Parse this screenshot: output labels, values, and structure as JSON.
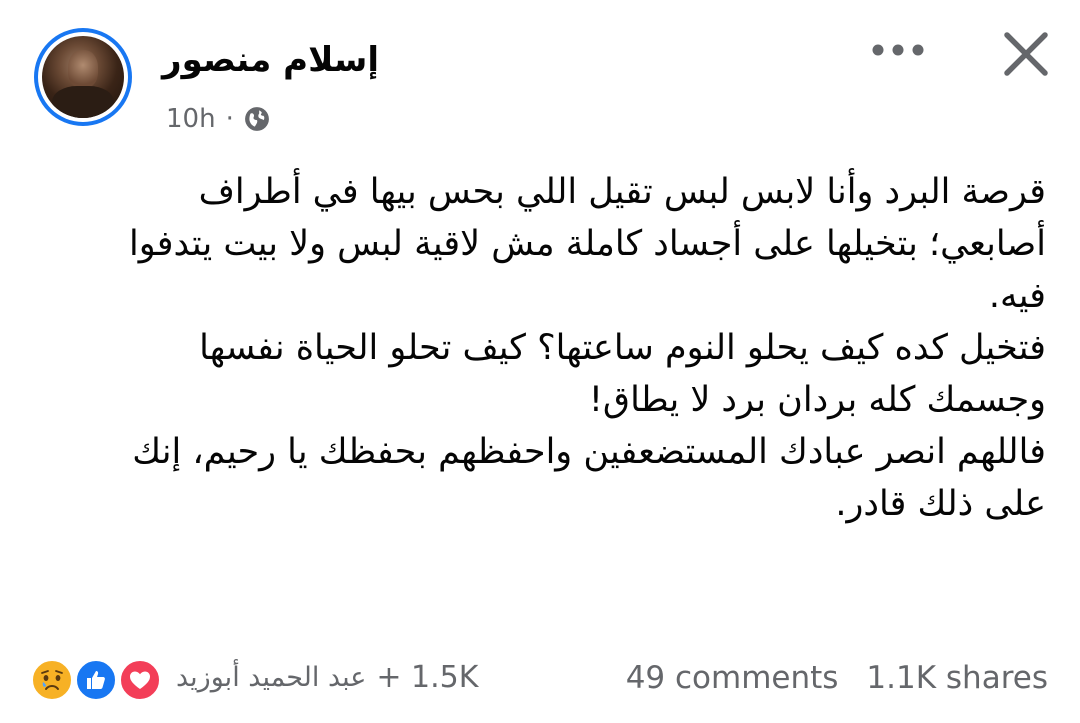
{
  "post": {
    "author": "إسلام منصور",
    "time": "10h",
    "separator": "·",
    "audience_icon": "globe-icon",
    "lines": [
      "قرصة البرد وأنا لابس لبس تقيل اللي بحس بيها في أطراف",
      "أصابعي؛ بتخيلها على أجساد كاملة مش لاقية لبس ولا بيت يتدفوا",
      "فيه.",
      "فتخيل كده كيف يحلو النوم ساعتها؟ كيف تحلو الحياة نفسها",
      "وجسمك كله بردان برد لا يطاق!",
      "فاللهم انصر عبادك المستضعفين واحفظهم بحفظك يا رحيم، إنك",
      "على ذلك قادر."
    ]
  },
  "header_actions": {
    "more_icon": "more-horizontal-icon",
    "close_icon": "close-icon"
  },
  "footer": {
    "reaction_icons": [
      "sad-reaction-icon",
      "like-reaction-icon",
      "love-reaction-icon"
    ],
    "reactor_name": "عبد الحميد أبوزيد",
    "others_count": "+ 1.5K",
    "comments": "49 comments",
    "shares": "1.1K shares"
  },
  "colors": {
    "accent": "#1877f2",
    "text_primary": "#050505",
    "text_secondary": "#65676b",
    "love": "#f33e58",
    "sad": "#f7b125"
  }
}
